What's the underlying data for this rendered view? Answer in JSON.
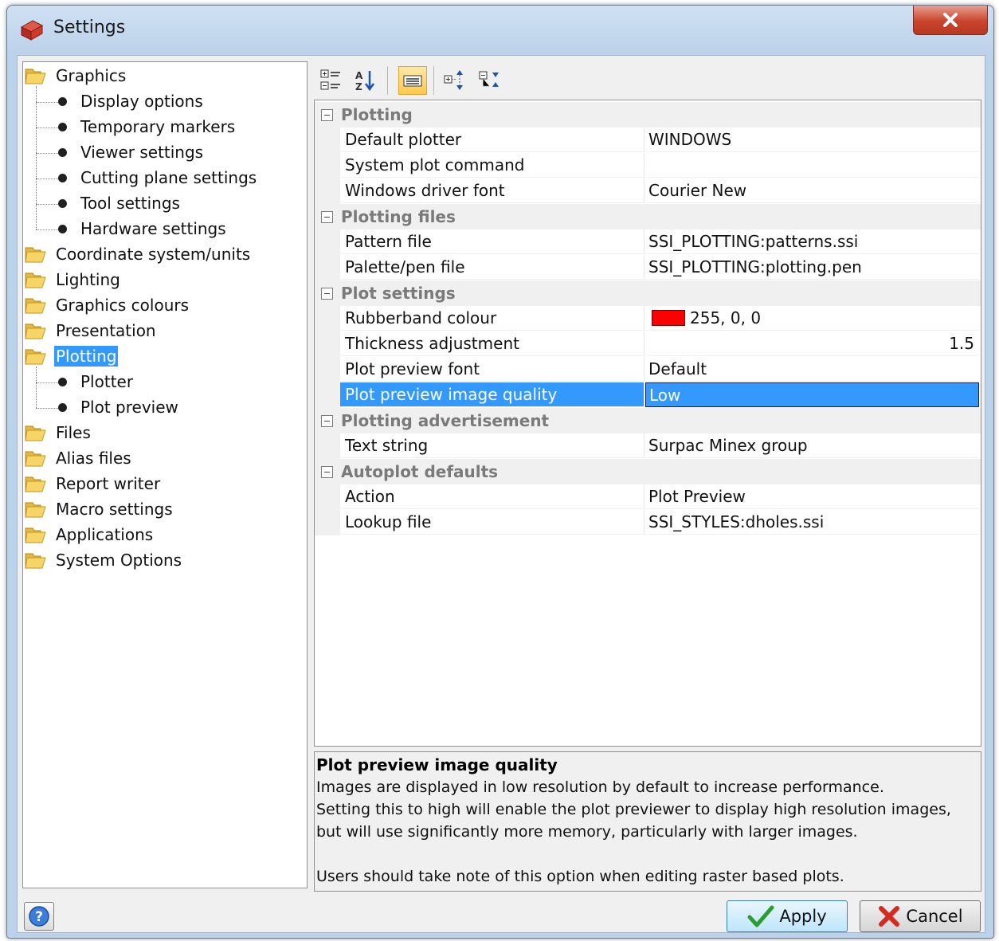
{
  "window": {
    "title": "Settings"
  },
  "tree": {
    "items": [
      {
        "label": "Graphics",
        "level": 0,
        "type": "folder"
      },
      {
        "label": "Display options",
        "level": 1,
        "type": "leaf"
      },
      {
        "label": "Temporary markers",
        "level": 1,
        "type": "leaf"
      },
      {
        "label": "Viewer settings",
        "level": 1,
        "type": "leaf"
      },
      {
        "label": "Cutting plane settings",
        "level": 1,
        "type": "leaf"
      },
      {
        "label": "Tool settings",
        "level": 1,
        "type": "leaf"
      },
      {
        "label": "Hardware settings",
        "level": 1,
        "type": "leaf"
      },
      {
        "label": "Coordinate system/units",
        "level": 0,
        "type": "folder"
      },
      {
        "label": "Lighting",
        "level": 0,
        "type": "folder"
      },
      {
        "label": "Graphics colours",
        "level": 0,
        "type": "folder"
      },
      {
        "label": "Presentation",
        "level": 0,
        "type": "folder"
      },
      {
        "label": "Plotting",
        "level": 0,
        "type": "folder",
        "selected": true
      },
      {
        "label": "Plotter",
        "level": 1,
        "type": "leaf"
      },
      {
        "label": "Plot preview",
        "level": 1,
        "type": "leaf"
      },
      {
        "label": "Files",
        "level": 0,
        "type": "folder"
      },
      {
        "label": "Alias files",
        "level": 0,
        "type": "folder"
      },
      {
        "label": "Report writer",
        "level": 0,
        "type": "folder"
      },
      {
        "label": "Macro settings",
        "level": 0,
        "type": "folder"
      },
      {
        "label": "Applications",
        "level": 0,
        "type": "folder"
      },
      {
        "label": "System Options",
        "level": 0,
        "type": "folder"
      }
    ]
  },
  "toolbar": {
    "buttons": [
      {
        "icon": "categorized-icon"
      },
      {
        "icon": "sort-alphabetical-icon"
      },
      {
        "icon": "property-pages-icon",
        "active": true
      },
      {
        "icon": "expand-all-icon"
      },
      {
        "icon": "collapse-all-icon"
      }
    ]
  },
  "grid": {
    "categories": [
      {
        "name": "Plotting",
        "rows": [
          {
            "name": "Default plotter",
            "value": "WINDOWS"
          },
          {
            "name": "System plot command",
            "value": ""
          },
          {
            "name": "Windows driver font",
            "value": "Courier New"
          }
        ]
      },
      {
        "name": "Plotting files",
        "rows": [
          {
            "name": "Pattern file",
            "value": "SSI_PLOTTING:patterns.ssi"
          },
          {
            "name": "Palette/pen file",
            "value": "SSI_PLOTTING:plotting.pen"
          }
        ]
      },
      {
        "name": "Plot settings",
        "rows": [
          {
            "name": "Rubberband colour",
            "value": "255, 0, 0",
            "swatch": "#ff0000"
          },
          {
            "name": "Thickness adjustment",
            "value": "1.5",
            "align": "right"
          },
          {
            "name": "Plot preview font",
            "value": "Default"
          },
          {
            "name": "Plot preview image quality",
            "value": "Low",
            "selected": true
          }
        ]
      },
      {
        "name": "Plotting advertisement",
        "rows": [
          {
            "name": "Text string",
            "value": "Surpac Minex group"
          }
        ]
      },
      {
        "name": "Autoplot defaults",
        "rows": [
          {
            "name": "Action",
            "value": "Plot Preview"
          },
          {
            "name": "Lookup file",
            "value": "SSI_STYLES:dholes.ssi"
          }
        ]
      }
    ]
  },
  "description": {
    "title": "Plot preview image quality",
    "text": "Images are displayed in low resolution by default to increase performance.\nSetting this to high will enable the plot previewer to display high resolution images, but will use significantly more memory, particularly with larger images.\n\nUsers should take note of this option when editing raster based plots."
  },
  "buttons": {
    "apply": "Apply",
    "cancel": "Cancel"
  },
  "colors": {
    "selection": "#3399ff",
    "swatch": "#ff0000",
    "close": "#c8442d"
  }
}
